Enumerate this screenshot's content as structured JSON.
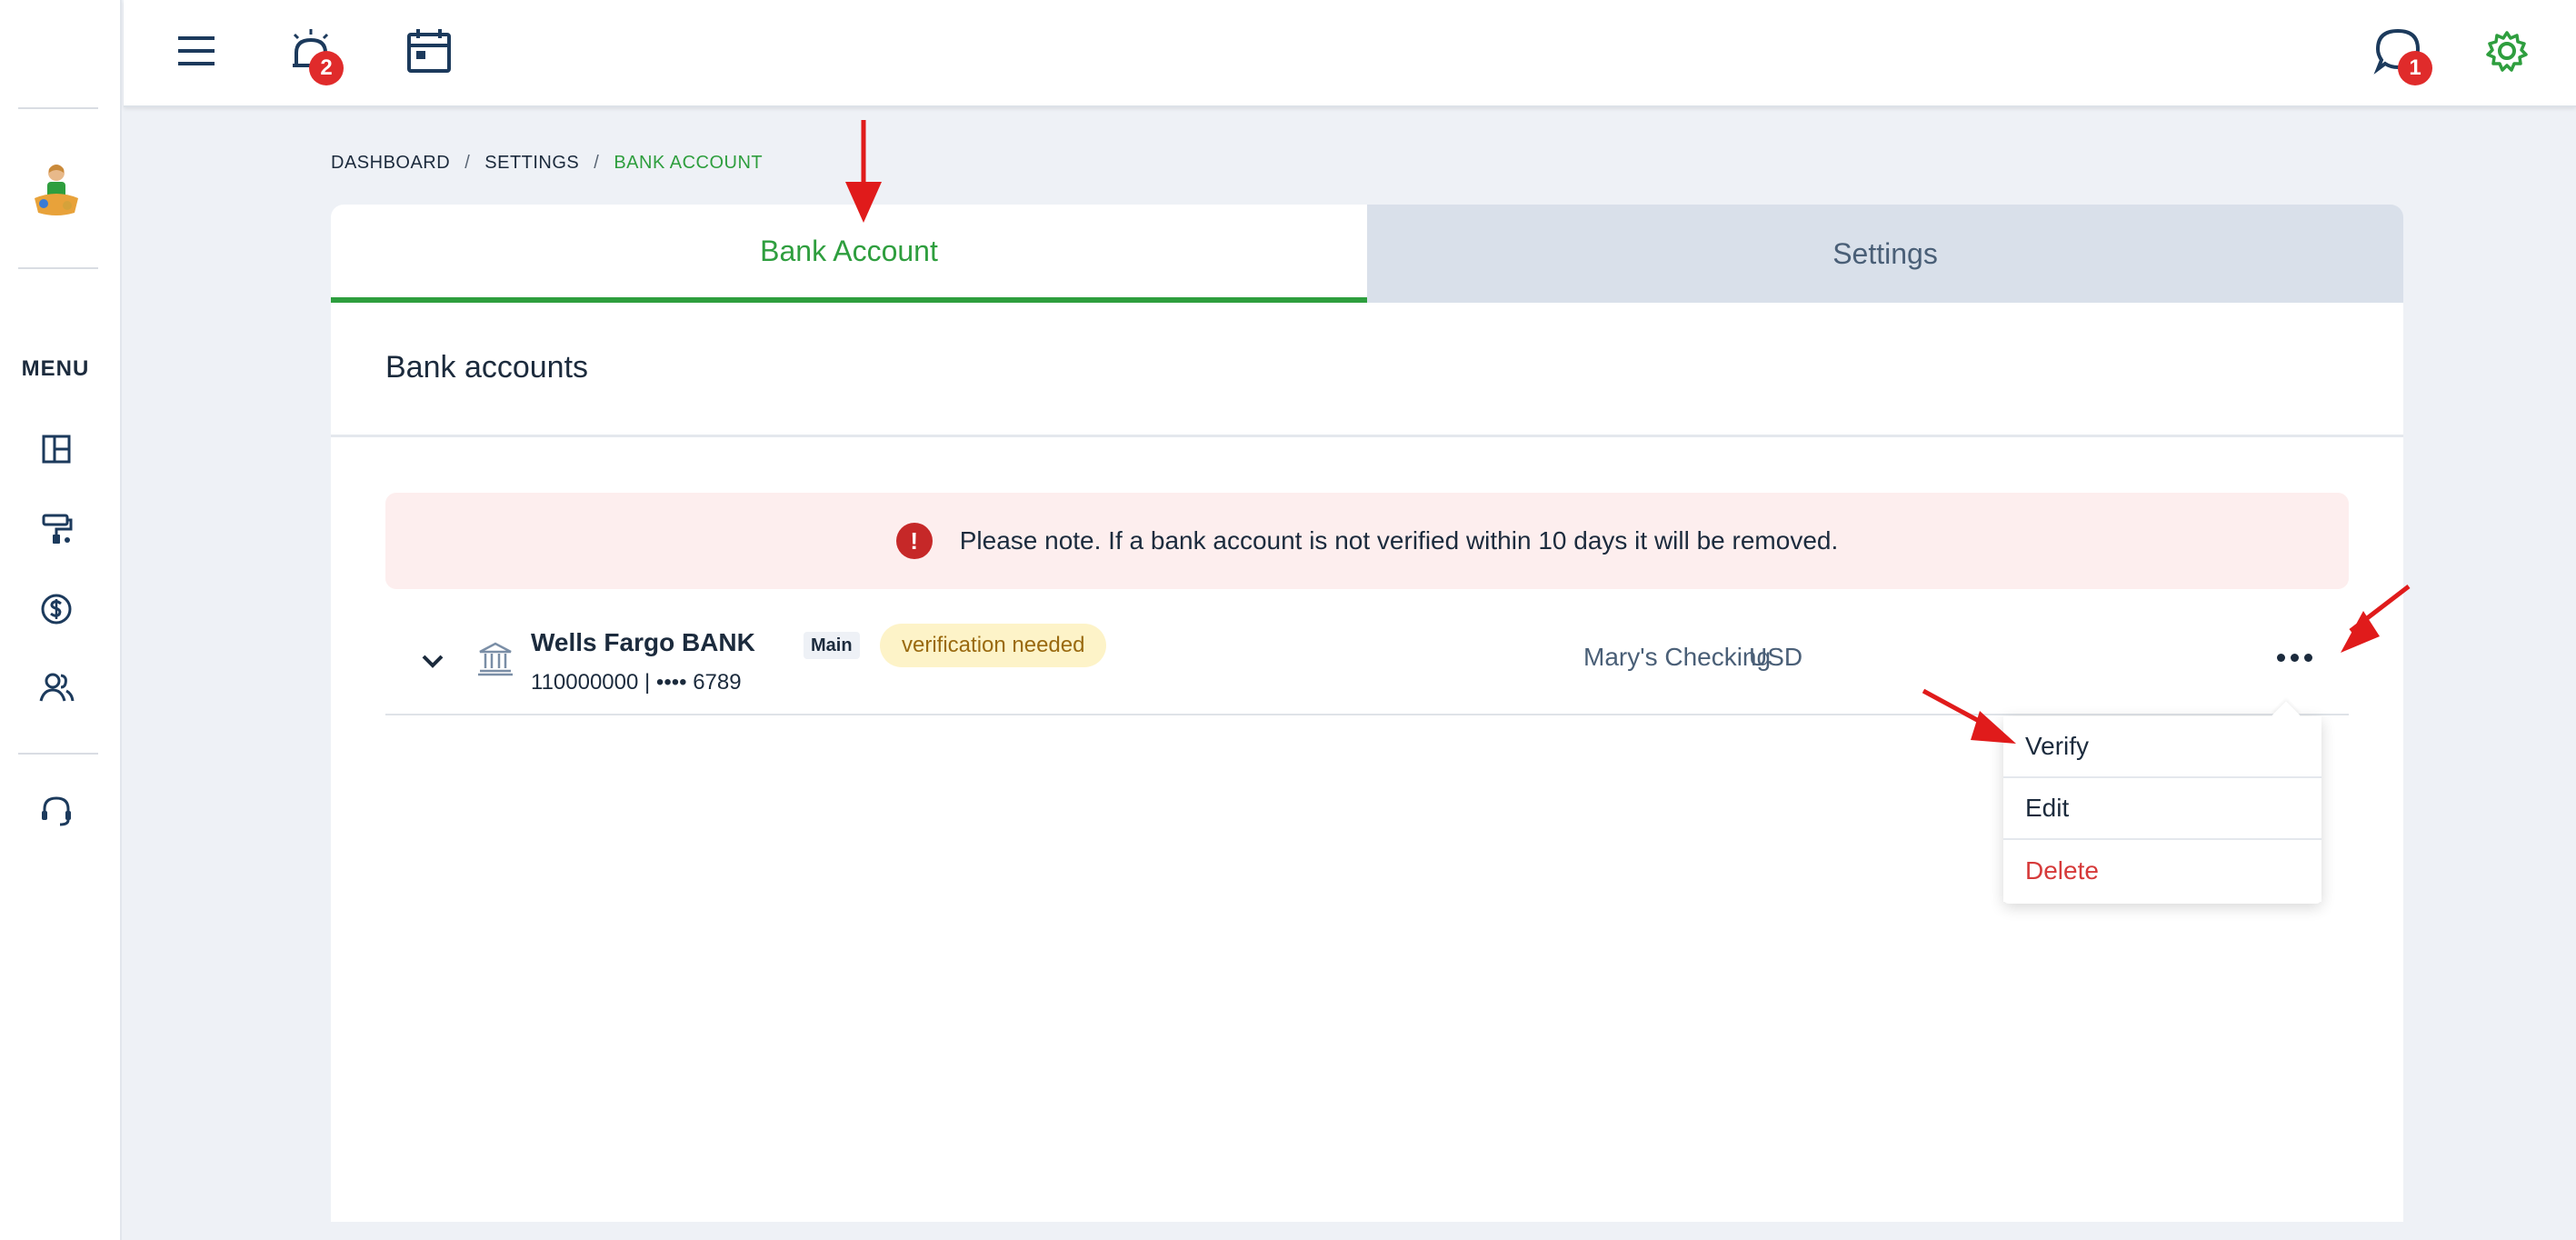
{
  "sidebar": {
    "menu_label": "MENU",
    "items": [
      {
        "icon": "dashboard-icon"
      },
      {
        "icon": "paint-roller-icon"
      },
      {
        "icon": "dollar-circle-icon"
      },
      {
        "icon": "users-icon"
      },
      {
        "icon": "headset-icon"
      }
    ]
  },
  "topbar": {
    "alarm_badge": "2",
    "chat_badge": "1",
    "accent_color": "#2e9e3e"
  },
  "breadcrumb": {
    "items": [
      "DASHBOARD",
      "SETTINGS",
      "BANK ACCOUNT"
    ],
    "separator": "/"
  },
  "tabs": [
    {
      "label": "Bank Account",
      "active": true
    },
    {
      "label": "Settings",
      "active": false
    }
  ],
  "card": {
    "title": "Bank accounts",
    "alert": "Please note. If a bank account is not verified within 10 days it will be removed."
  },
  "account": {
    "bank_name": "Wells Fargo BANK",
    "main_tag": "Main",
    "status": "verification needed",
    "number": "110000000 | •••• 6789",
    "nickname": "Mary's Checking",
    "currency": "USD"
  },
  "dropdown": {
    "items": [
      {
        "label": "Verify"
      },
      {
        "label": "Edit"
      },
      {
        "label": "Delete"
      }
    ]
  }
}
